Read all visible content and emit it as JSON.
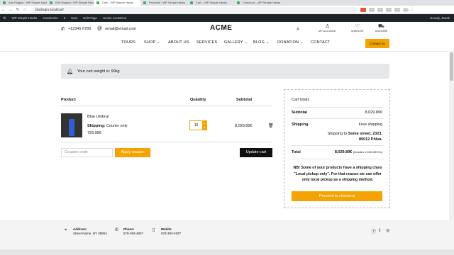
{
  "browser": {
    "tabs": [
      "Add Plugins ‹ WP Simple Hacks",
      "Edit Snippet ‹ WP Simple Hacks",
      "Cart – WP Simple Hacks",
      "Products ‹ WP Simple Hacks",
      "Cart – WP Simple Hacks",
      "Checkout – WP Simple Hacks"
    ],
    "url": "blockspro.local/cart/"
  },
  "adminbar": {
    "site": "WP Simple Hacks",
    "customize": "Customize",
    "comments": "0",
    "new": "New",
    "edit": "Edit Page",
    "hooks": "Hooks Locations",
    "howdy": "Howdy, Janek"
  },
  "header": {
    "phone": "+12345 6789",
    "email": "email@email.com",
    "logo": "ACME",
    "account": "MY ACCOUNT",
    "wishlist": "WISHLIST",
    "wishlist_count": "0",
    "cart_total": "8,029.89€",
    "cart_count": "1",
    "menu": [
      "TOURS",
      "SHOP",
      "ABOUT US",
      "SERVICES",
      "GALLERY",
      "BLOG",
      "DONATION",
      "CONTACT"
    ],
    "contact_button": "Contact us"
  },
  "notice": "Your cart weight is: 99kg",
  "table": {
    "headers": {
      "product": "Product",
      "quantity": "Quantity",
      "subtotal": "Subtotal"
    },
    "item": {
      "name": "Blue Umbral",
      "shipping_label": "Shipping:",
      "shipping_value": "Courier only",
      "price": "729.99€",
      "quantity": "10",
      "subtotal": "8,029.89€"
    },
    "coupon_placeholder": "Coupon code",
    "apply": "Apply coupon",
    "update": "Update cart"
  },
  "totals": {
    "title": "Cart totals",
    "subtotal_label": "Subtotal",
    "subtotal": "8,029.89€",
    "shipping_label": "Shipping",
    "shipping_value": "Free shipping",
    "shipping_to": "Shipping to",
    "address_line1": "Some street, 2323,",
    "address_line2": "89012 Põlva.",
    "total_label": "Total",
    "total": "8,029.89€",
    "tax_note": "(includes 1,338.31€ Km)",
    "nb": "NB! Some of your products have a shipping class \"Local pickup only\". For that reason we can offer only local pickup as a shipping method.",
    "checkout": "Proceed to checkout"
  },
  "footer": {
    "address_label": "Address:",
    "address": "Street Name, NY 38954",
    "phone_label": "Phone:",
    "phone": "578-393-4937",
    "mobile_label": "Mobile:",
    "mobile": "578-393-4937"
  }
}
